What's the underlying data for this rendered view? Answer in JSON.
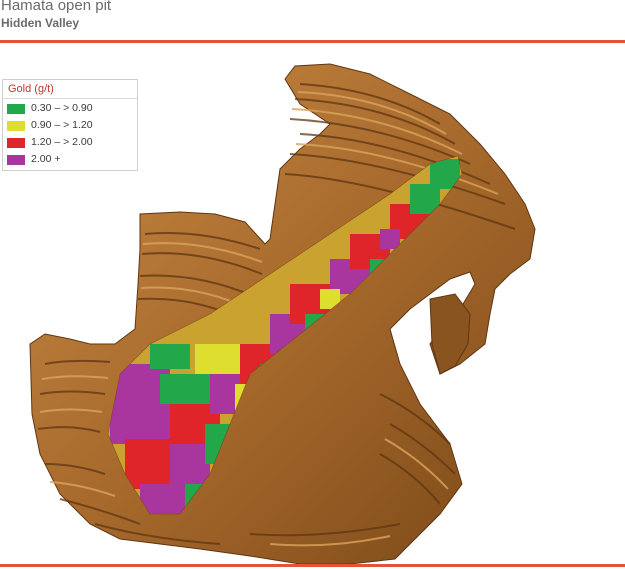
{
  "header": {
    "title": "Hamata open pit",
    "subtitle": "Hidden Valley",
    "accent_color": "#e2533c"
  },
  "legend": {
    "title": "Gold (g/t)",
    "items": [
      {
        "label": "0.30 – > 0.90",
        "color": "#22a84a"
      },
      {
        "label": "0.90 – > 1.20",
        "color": "#dede2e"
      },
      {
        "label": "1.20 – > 2.00",
        "color": "#e0252a"
      },
      {
        "label": "2.00 +",
        "color": "#a9369f"
      }
    ]
  },
  "pit_model": {
    "shell_color": "#a86a2c",
    "shell_highlight": "#d9a55e",
    "shell_shadow": "#5e3612"
  }
}
